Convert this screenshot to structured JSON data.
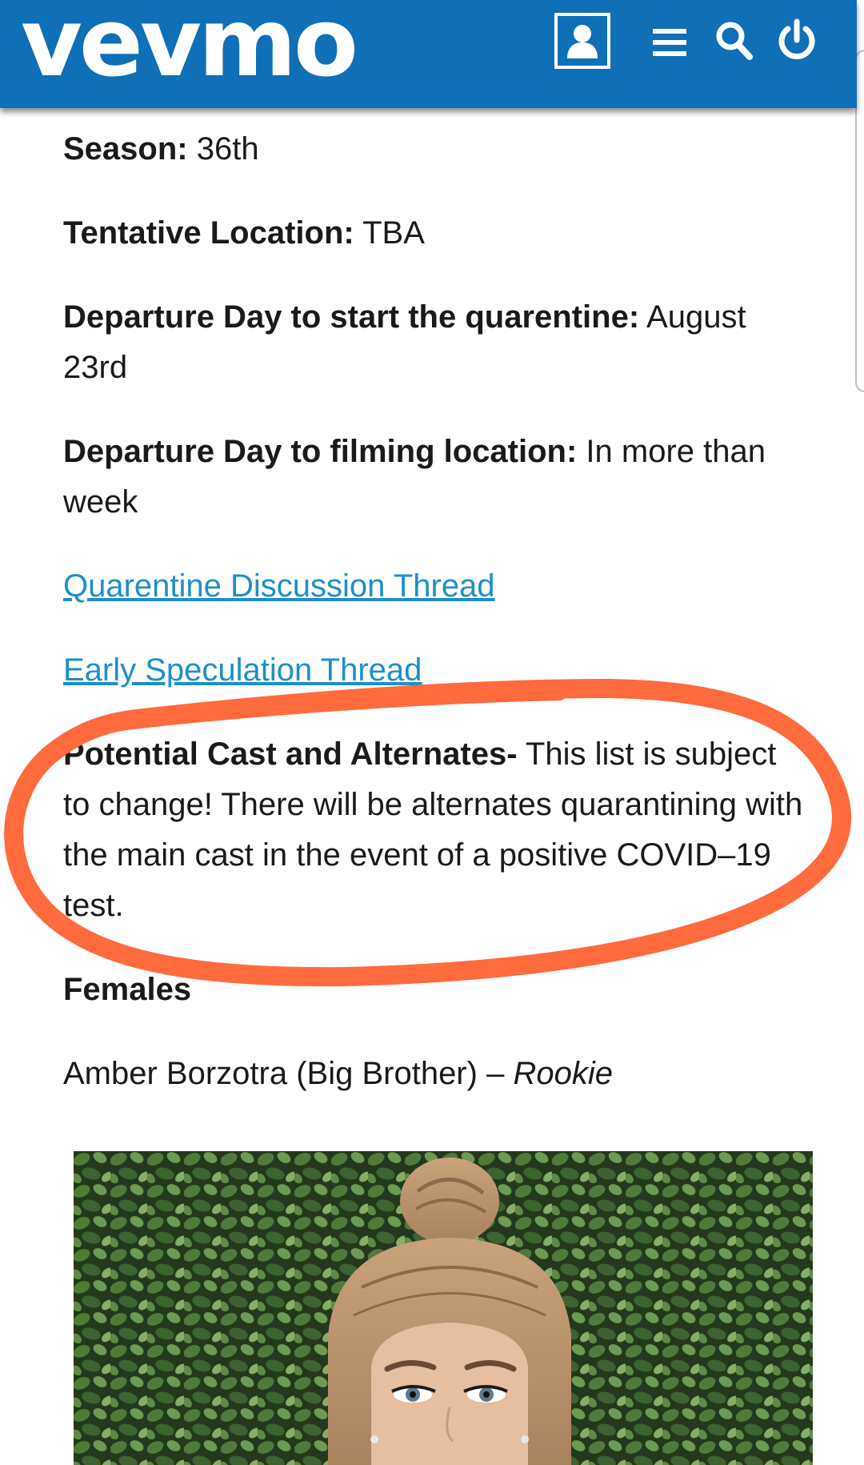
{
  "header": {
    "logo_text": "vevmo",
    "bar_color": "#0f6fb7",
    "icons": [
      "profile-icon",
      "menu-icon",
      "search-icon",
      "power-icon"
    ]
  },
  "info": {
    "season_label": "Season:",
    "season_value": "36th",
    "location_label": "Tentative Location:",
    "location_value": "TBA",
    "quarantine_label": "Departure Day to start the quarentine:",
    "quarantine_value": "August 23rd",
    "filming_label": "Departure Day to filming location:",
    "filming_value": "In more than week"
  },
  "links": {
    "quarantine_thread": "Quarentine Discussion Thread",
    "speculation_thread": "Early Speculation Thread",
    "link_color": "#1f8fc9"
  },
  "cast_notice": {
    "label": "Potential Cast and Alternates-",
    "text": "This list is subject to change! There will be alternates quarantining with the main cast in the event of a positive COVID–19 test.",
    "highlight_color": "#ff6b3d"
  },
  "females": {
    "heading": "Females",
    "first_entry_name": "Amber Borzotra (Big Brother) –",
    "first_entry_status": "Rookie"
  }
}
